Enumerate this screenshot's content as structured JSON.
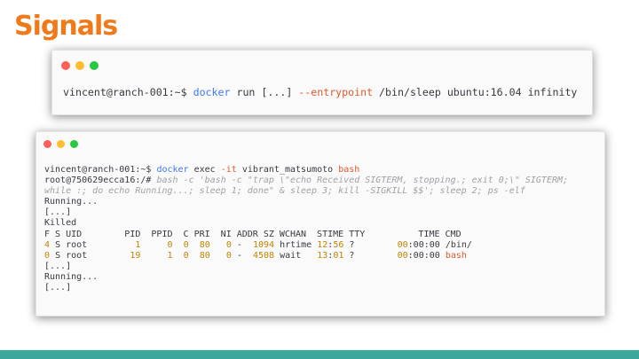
{
  "slide_title": "Signals",
  "terminal1": {
    "prompt": "vincent@ranch-001:~$",
    "cmd": "docker",
    "sub": "run",
    "ellipsis": "[...]",
    "flag": "--entrypoint",
    "rest": "/bin/sleep ubuntu:16.04 infinity"
  },
  "terminal2": {
    "prompt": "vincent@ranch-001:~$",
    "cmd": "docker",
    "sub": "exec",
    "flag": "-it",
    "container": "vibrant_matsumoto",
    "shell": "bash",
    "root_prompt": "root@750629ecca16:/#",
    "comment_line1": "bash -c 'bash -c \"trap \\\"echo Received SIGTERM, stopping.; exit 0;\\\" SIGTERM;",
    "comment_line2": "while :; do echo Running...; sleep 1; done\" & sleep 3; kill -SIGKILL $$'; sleep 2; ps -elf",
    "out_running1": "Running...",
    "out_ellipsis1": "[...]",
    "out_killed": "Killed",
    "ps_header": "F S UID        PID  PPID  C PRI  NI ADDR SZ WCHAN  STIME TTY          TIME CMD",
    "ps_rows": [
      {
        "f": "4",
        "s": "S",
        "uid": "root",
        "pid": "1",
        "ppid": "0",
        "c": "0",
        "pri": "80",
        "ni": "0",
        "addr": "-",
        "sz": "1094",
        "wchan": "hrtime",
        "stime_h": "12",
        "stime_m": "56",
        "tty": "?",
        "time_a": "00",
        "time_b": "00:00",
        "cmd": "/bin/"
      },
      {
        "f": "0",
        "s": "S",
        "uid": "root",
        "pid": "19",
        "ppid": "1",
        "c": "0",
        "pri": "80",
        "ni": "0",
        "addr": "-",
        "sz": "4508",
        "wchan": "wait",
        "stime_h": "13",
        "stime_m": "01",
        "tty": "?",
        "time_a": "00",
        "time_b": "00:00",
        "cmd": "bash"
      }
    ],
    "out_ellipsis2": "[...]",
    "out_running2": "Running...",
    "out_ellipsis3": "[...]"
  },
  "colors": {
    "title": "#f07a1a",
    "keyword": "#4078f2",
    "accent": "#e05a2b",
    "number": "#c18401",
    "comment": "#a0a1a7",
    "bottom_bar": "#3aa79a"
  }
}
